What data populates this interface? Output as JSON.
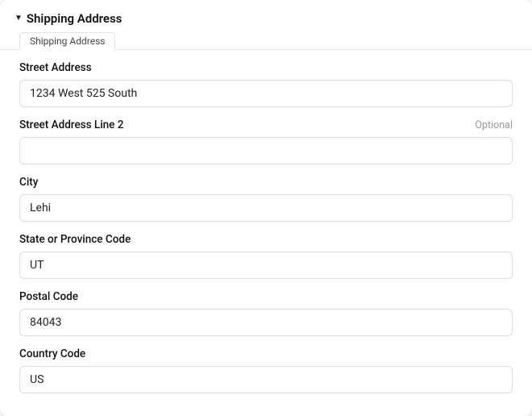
{
  "section": {
    "title": "Shipping Address",
    "tab_label": "Shipping Address"
  },
  "fields": {
    "street": {
      "label": "Street Address",
      "value": "1234 West 525 South"
    },
    "street2": {
      "label": "Street Address Line 2",
      "optional_text": "Optional",
      "value": ""
    },
    "city": {
      "label": "City",
      "value": "Lehi"
    },
    "state": {
      "label": "State or Province Code",
      "value": "UT"
    },
    "postal": {
      "label": "Postal Code",
      "value": "84043"
    },
    "country": {
      "label": "Country Code",
      "value": "US"
    }
  }
}
